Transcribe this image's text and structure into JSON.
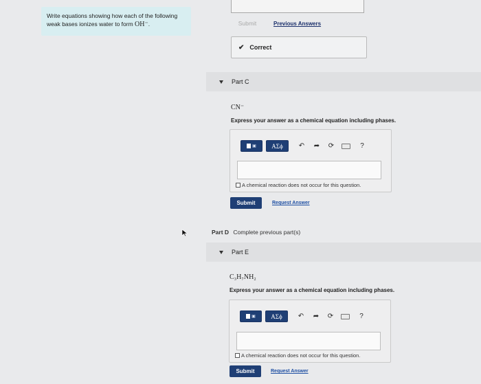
{
  "prompt": {
    "line1": "Write equations showing how each of the following",
    "line2": "weak bases ionizes water to form ",
    "ion": "OH⁻",
    "tail": "."
  },
  "previous_part": {
    "submit_label": "Submit",
    "previous_answers_label": "Previous Answers",
    "feedback_label": "Correct"
  },
  "part_c": {
    "title": "Part C",
    "species": "CN⁻",
    "instruction": "Express your answer as a chemical equation including phases.",
    "greek_label": "AΣϕ",
    "help_label": "?",
    "no_reaction_label": "A chemical reaction does not occur for this question.",
    "submit_label": "Submit",
    "request_answer_label": "Request Answer"
  },
  "part_d": {
    "label": "Part D",
    "status": "Complete previous part(s)"
  },
  "part_e": {
    "title": "Part E",
    "species": "C₃H₇NH₂",
    "instruction": "Express your answer as a chemical equation including phases.",
    "greek_label": "AΣϕ",
    "help_label": "?",
    "no_reaction_label": "A chemical reaction does not occur for this question.",
    "submit_label": "Submit",
    "request_answer_label": "Request Answer"
  },
  "icons": [
    "check-icon",
    "collapse-triangle-icon",
    "template-icon",
    "undo-icon",
    "redo-icon",
    "reset-icon",
    "keyboard-icon",
    "help-icon",
    "mouse-cursor-icon"
  ],
  "colors": {
    "primary_button": "#1f3f75",
    "prompt_bg": "#d8eef1",
    "link": "#1a2f6b"
  }
}
